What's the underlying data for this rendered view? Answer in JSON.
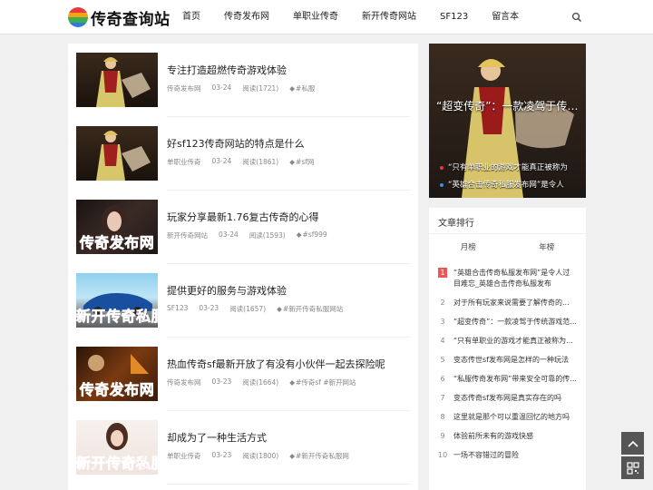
{
  "header": {
    "logo_text": "传奇查询站",
    "nav": [
      "首页",
      "传奇发布网",
      "单职业传奇",
      "新开传奇网站",
      "SF123",
      "留言本"
    ]
  },
  "posts": [
    {
      "title": "专注打造超燃传奇游戏体验",
      "category": "传奇发布网",
      "date": "03-24",
      "reads": "阅读(1721)",
      "tags": "#私服",
      "thumb_caption": ""
    },
    {
      "title": "好sf123传奇网站的特点是什么",
      "category": "单职业传奇",
      "date": "03-24",
      "reads": "阅读(1861)",
      "tags": "#sf网",
      "thumb_caption": ""
    },
    {
      "title": "玩家分享最新1.76复古传奇的心得",
      "category": "新开传奇网站",
      "date": "03-24",
      "reads": "阅读(1593)",
      "tags": "#sf999",
      "thumb_caption": "传奇发布网"
    },
    {
      "title": "提供更好的服务与游戏体验",
      "category": "SF123",
      "date": "03-23",
      "reads": "阅读(1657)",
      "tags": "#新开传奇私服网站",
      "thumb_caption": "新开传奇私服"
    },
    {
      "title": "热血传奇sf最新开放了有没有小伙伴一起去探险呢",
      "category": "传奇发布网",
      "date": "03-23",
      "reads": "阅读(1664)",
      "tags": "#传奇sf #新开网站",
      "thumb_caption": "传奇发布网"
    },
    {
      "title": "却成为了一种生活方式",
      "category": "单职业传奇",
      "date": "03-23",
      "reads": "阅读(1800)",
      "tags": "#新开传奇私服网",
      "thumb_caption": "新开传奇私服"
    }
  ],
  "feature": {
    "title": "“超变传奇”：一款凌驾于传统游戏",
    "links": [
      "“只有单职业的游戏才能真正被称为",
      "“英雄合击传奇私服发布网”是令人"
    ]
  },
  "ranking": {
    "heading": "文章排行",
    "tabs": [
      "月榜",
      "年榜"
    ],
    "items": [
      "“英雄合击传奇私服发布网”是令人过目难忘_英雄合击传奇私服发布",
      "对于所有玩家来说需要了解传奇的...",
      "“超变传奇”：一款凌驾于传统游戏范...",
      "“只有单职业的游戏才能真正被称为...",
      "变态传世sf发布网是怎样的一种玩法",
      "“私服传奇发布网”带来安全可靠的传...",
      "变态传奇sf发布网是真实存在的吗",
      "这里就是那个可以重温回忆的地方吗",
      "体验前所未有的游戏快感",
      "一场不容错过的冒险"
    ]
  },
  "colors": {
    "accent": "#e55555",
    "link_blue": "#3a8ee6"
  }
}
